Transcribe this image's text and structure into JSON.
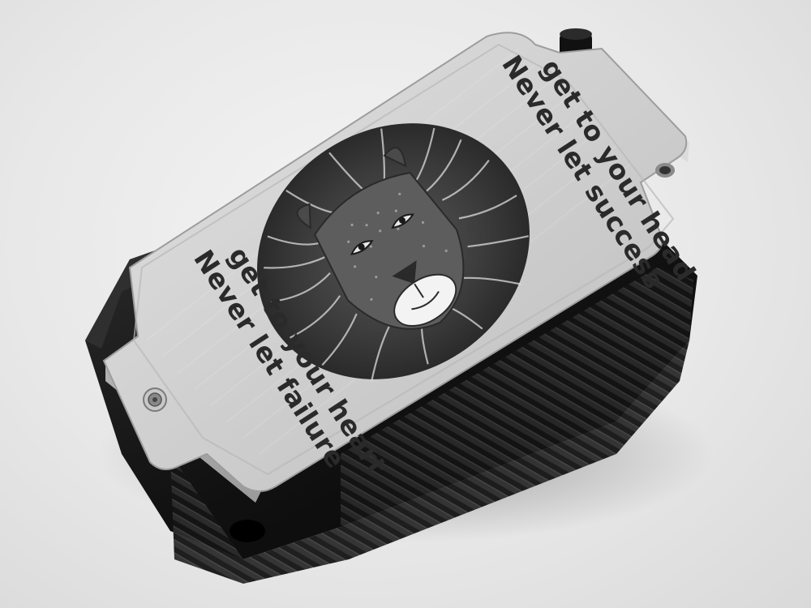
{
  "photo": {
    "subject": "engraved aluminum plate on black ridged wallet case",
    "colors": {
      "background": "#e9e9e9",
      "plate": "#d4d4d4",
      "case": "#151515",
      "engraving": "#2a2a2a"
    }
  },
  "engraving": {
    "top_quote": {
      "line1": "Never let success",
      "line2": "get to your head"
    },
    "bottom_quote": {
      "line1": "Never let failure",
      "line2": "get to your heart"
    },
    "artwork": "lion-head-illustration"
  }
}
